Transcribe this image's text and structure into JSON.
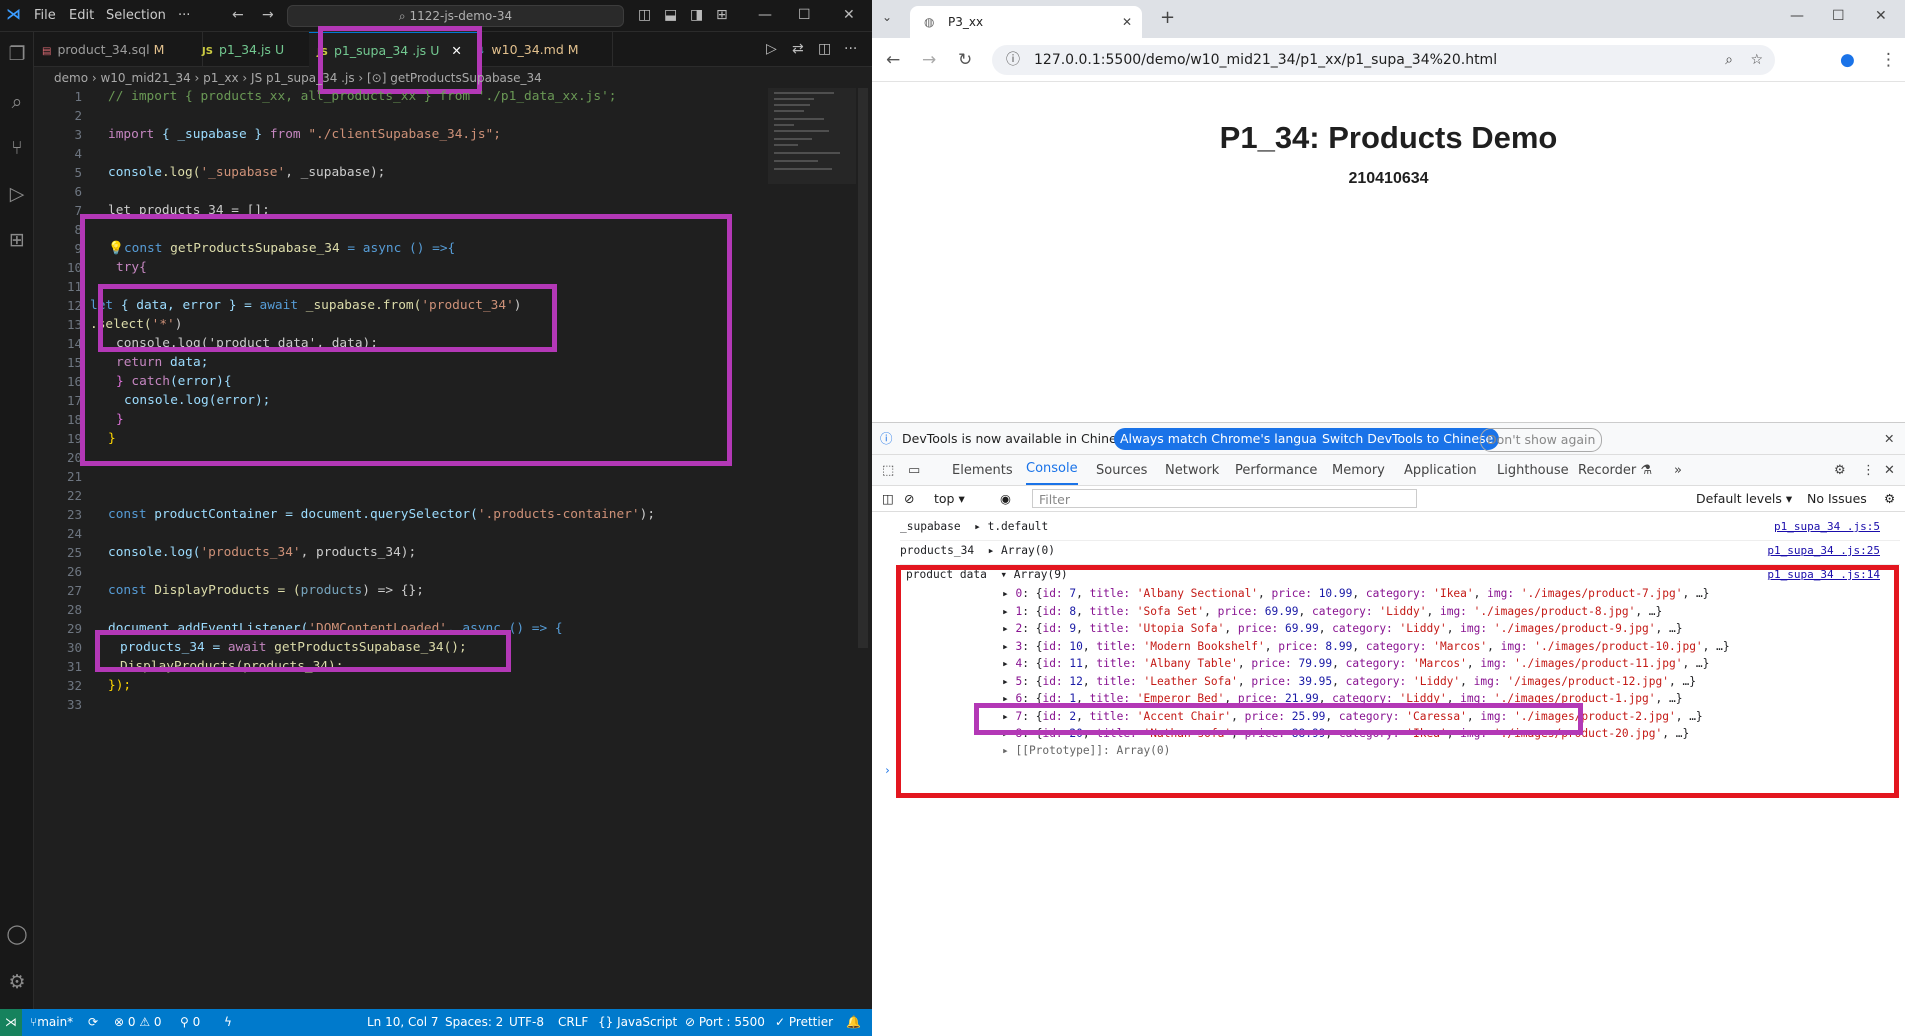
{
  "vscode": {
    "menu": [
      "File",
      "Edit",
      "Selection",
      "···"
    ],
    "command_center": "1122-js-demo-34",
    "tabs": [
      {
        "icon": "▤",
        "label": "product_34.sql",
        "badge": "M"
      },
      {
        "icon": "JS",
        "label": "p1_34.js",
        "badge": "U"
      },
      {
        "icon": "JS",
        "label": "p1_supa_34 .js",
        "badge": "U"
      },
      {
        "icon": "⬇",
        "label": "w10_34.md",
        "badge": "M"
      }
    ],
    "breadcrumb": "demo  ›  w10_mid21_34  ›  p1_xx  ›  JS p1_supa_34 .js  ›  [⊙] getProductsSupabase_34",
    "line_numbers": [
      "1",
      "2",
      "3",
      "4",
      "5",
      "6",
      "7",
      "8",
      "9",
      "10",
      "11",
      "12",
      "13",
      "14",
      "15",
      "16",
      "17",
      "18",
      "19",
      "20",
      "21",
      "22",
      "23",
      "24",
      "25",
      "26",
      "27",
      "28",
      "29",
      "30",
      "31",
      "32",
      "33"
    ],
    "code": {
      "l1": "// import { products_xx, all_products_xx } from './p1_data_xx.js';",
      "l3a": "import",
      "l3b": " { _supabase } ",
      "l3c": "from",
      "l3d": " \"./clientSupabase_34.js\";",
      "l5a": "console",
      "l5b": ".log(",
      "l5c": "'_supabase'",
      "l5d": ", _supabase);",
      "l7": "let products_34 = [];",
      "l9a": "const",
      "l9b": " getProductsSupabase_34 ",
      "l9c": "= async () =>{",
      "l10": "try{",
      "l12a": "let",
      "l12b": " { data, error } = ",
      "l12c": "await",
      "l12d": " _supabase.from(",
      "l12e": "'product_34'",
      "l12f": ")",
      "l13a": ".select(",
      "l13b": "'*'",
      "l13c": ")",
      "l14": "console.log('product data', data);",
      "l15a": "return",
      "l15b": " data;",
      "l16a": "} ",
      "l16b": "catch",
      "l16c": "(error){",
      "l17": "console.log(error);",
      "l18": "}",
      "l19": "}",
      "l23a": "const",
      "l23b": " productContainer = document.querySelector(",
      "l23c": "'.products-container'",
      "l23d": ");",
      "l25a": "console.log(",
      "l25b": "'products_34'",
      "l25c": ", products_34);",
      "l27a": "const",
      "l27b": " DisplayProducts = (",
      "l27c": "products",
      "l27d": ") => {};",
      "l29a": "document.addEventListener(",
      "l29b": "'DOMContentLoaded'",
      "l29c": ", async () => {",
      "l30a": "products_34 = ",
      "l30b": "await",
      "l30c": " getProductsSupabase_34();",
      "l31": "DisplayProducts(products_34);",
      "l32": "});"
    },
    "status": {
      "branch": "main*",
      "sync": "⟳",
      "problems": "⊗ 0 ⚠ 0",
      "ports": "⚲ 0",
      "position": "Ln 10, Col 7",
      "spaces": "Spaces: 2",
      "encoding": "UTF-8",
      "eol": "CRLF",
      "language": "{} JavaScript",
      "port": "⊘ Port : 5500",
      "prettier": "✓ Prettier"
    }
  },
  "chrome": {
    "tab_title": "P3_xx",
    "url": "127.0.0.1:5500/demo/w10_mid21_34/p1_xx/p1_supa_34%20.html",
    "page_title": "P1_34: Products Demo",
    "page_subtitle": "210410634",
    "devtools_banner": {
      "text": "DevTools is now available in Chinese!",
      "btn1": "Always match Chrome's language",
      "btn2": "Switch DevTools to Chinese",
      "btn3": "Don't show again"
    },
    "devtools_tabs": [
      "Elements",
      "Console",
      "Sources",
      "Network",
      "Performance",
      "Memory",
      "Application",
      "Lighthouse",
      "Recorder ⚗",
      "»"
    ],
    "filter": {
      "context": "top ▾",
      "placeholder": "Filter",
      "levels": "Default levels ▾",
      "issues": "No Issues"
    },
    "console": [
      {
        "label": "_supabase",
        "value": "▸ t.default",
        "src": "p1_supa_34 .js:5"
      },
      {
        "label": "products_34",
        "value": "▸ Array(0)",
        "src": "p1_supa_34 .js:25"
      },
      {
        "label": "product data",
        "value": "▾ Array(9)",
        "src": "p1_supa_34 .js:14"
      }
    ],
    "products": [
      {
        "idx": "0",
        "id": "7",
        "title": "'Albany Sectional'",
        "price": "10.99",
        "category": "'Ikea'",
        "img": "'./images/product-7.jpg'"
      },
      {
        "idx": "1",
        "id": "8",
        "title": "'Sofa Set'",
        "price": "69.99",
        "category": "'Liddy'",
        "img": "'./images/product-8.jpg'"
      },
      {
        "idx": "2",
        "id": "9",
        "title": "'Utopia Sofa'",
        "price": "69.99",
        "category": "'Liddy'",
        "img": "'./images/product-9.jpg'"
      },
      {
        "idx": "3",
        "id": "10",
        "title": "'Modern Bookshelf'",
        "price": "8.99",
        "category": "'Marcos'",
        "img": "'./images/product-10.jpg'"
      },
      {
        "idx": "4",
        "id": "11",
        "title": "'Albany Table'",
        "price": "79.99",
        "category": "'Marcos'",
        "img": "'./images/product-11.jpg'"
      },
      {
        "idx": "5",
        "id": "12",
        "title": "'Leather Sofa'",
        "price": "39.95",
        "category": "'Liddy'",
        "img": "'/images/product-12.jpg'"
      },
      {
        "idx": "6",
        "id": "1",
        "title": "'Emperor Bed'",
        "price": "21.99",
        "category": "'Liddy'",
        "img": "'./images/product-1.jpg'"
      },
      {
        "idx": "7",
        "id": "2",
        "title": "'Accent Chair'",
        "price": "25.99",
        "category": "'Caressa'",
        "img": "'./images/product-2.jpg'"
      },
      {
        "idx": "8",
        "id": "20",
        "title": "'Nathan sofa'",
        "price": "88.99",
        "category": "'Ikea'",
        "img": "'./images/product-20.jpg'"
      }
    ],
    "prototype": "▸ [[Prototype]]: Array(0)"
  }
}
